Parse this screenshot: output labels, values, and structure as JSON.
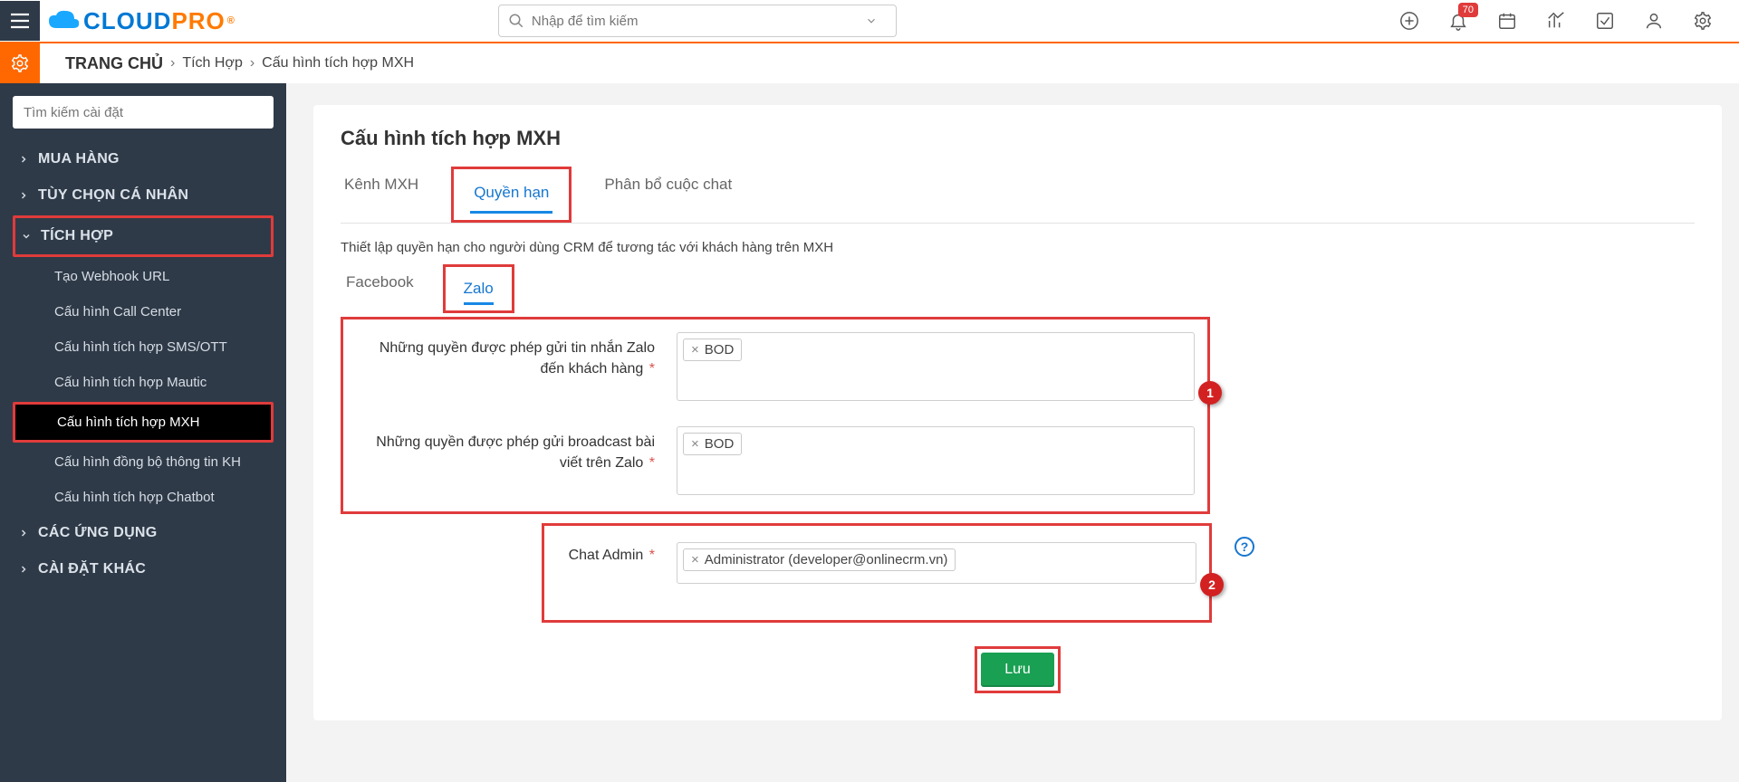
{
  "header": {
    "logo_cloud": "CLOUD",
    "logo_pro": "PRO",
    "search_placeholder": "Nhập để tìm kiếm",
    "notification_count": "70"
  },
  "breadcrumb": {
    "home": "TRANG CHỦ",
    "level1": "Tích Hợp",
    "level2": "Cấu hình tích hợp MXH"
  },
  "sidebar": {
    "search_placeholder": "Tìm kiếm cài đặt",
    "items": [
      {
        "label": "MUA HÀNG",
        "expanded": false
      },
      {
        "label": "TÙY CHỌN CÁ NHÂN",
        "expanded": false
      },
      {
        "label": "TÍCH HỢP",
        "expanded": true,
        "highlight": true,
        "children": [
          {
            "label": "Tạo Webhook URL"
          },
          {
            "label": "Cấu hình Call Center"
          },
          {
            "label": "Cấu hình tích hợp SMS/OTT"
          },
          {
            "label": "Cấu hình tích hợp Mautic"
          },
          {
            "label": "Cấu hình tích hợp MXH",
            "active": true,
            "highlight": true
          },
          {
            "label": "Cấu hình đồng bộ thông tin KH"
          },
          {
            "label": "Cấu hình tích hợp Chatbot"
          }
        ]
      },
      {
        "label": "CÁC ỨNG DỤNG",
        "expanded": false
      },
      {
        "label": "CÀI ĐẶT KHÁC",
        "expanded": false
      }
    ]
  },
  "main": {
    "title": "Cấu hình tích hợp MXH",
    "tabs": [
      {
        "label": "Kênh MXH"
      },
      {
        "label": "Quyền hạn",
        "active": true,
        "highlight": true
      },
      {
        "label": "Phân bổ cuộc chat"
      }
    ],
    "description": "Thiết lập quyền hạn cho người dùng CRM để tương tác với khách hàng trên MXH",
    "subtabs": [
      {
        "label": "Facebook"
      },
      {
        "label": "Zalo",
        "active": true,
        "highlight": true
      }
    ],
    "fields": {
      "send_msg_label": "Những quyền được phép gửi tin nhắn Zalo đến khách hàng",
      "send_msg_tags": [
        "BOD"
      ],
      "broadcast_label": "Những quyền được phép gửi broadcast bài viết trên Zalo",
      "broadcast_tags": [
        "BOD"
      ],
      "chat_admin_label": "Chat Admin",
      "chat_admin_tags": [
        "Administrator (developer@onlinecrm.vn)"
      ]
    },
    "callouts": {
      "one": "1",
      "two": "2"
    },
    "save_label": "Lưu"
  }
}
